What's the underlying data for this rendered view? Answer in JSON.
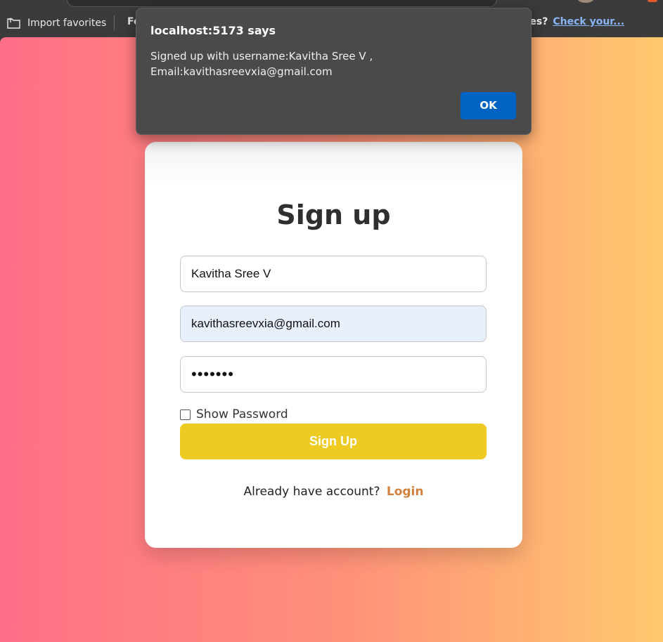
{
  "favorites_bar": {
    "import_label": "Import favorites",
    "folder_label": "Fo",
    "prompt_text": "rites?",
    "prompt_link": "Check your..."
  },
  "signup": {
    "heading": "Sign up",
    "username_value": "Kavitha Sree V",
    "email_value": "kavithasreevxia@gmail.com",
    "password_mask": "•••••••",
    "show_password_label": "Show Password",
    "show_password_checked": false,
    "button_label": "Sign Up",
    "login_prompt": "Already have account?",
    "login_link": "Login"
  },
  "dialog": {
    "title": "localhost:5173 says",
    "message_line1": "Signed up with username:Kavitha Sree V ,",
    "message_line2": "Email:kavithasreevxia@gmail.com",
    "ok_label": "OK"
  },
  "colors": {
    "gradient_left": "#ff6f87",
    "gradient_right": "#ffc86e",
    "button": "#eecb22",
    "login_link": "#d3813a",
    "dialog_bg": "#4a4a4a",
    "ok_button": "#0063c4"
  }
}
